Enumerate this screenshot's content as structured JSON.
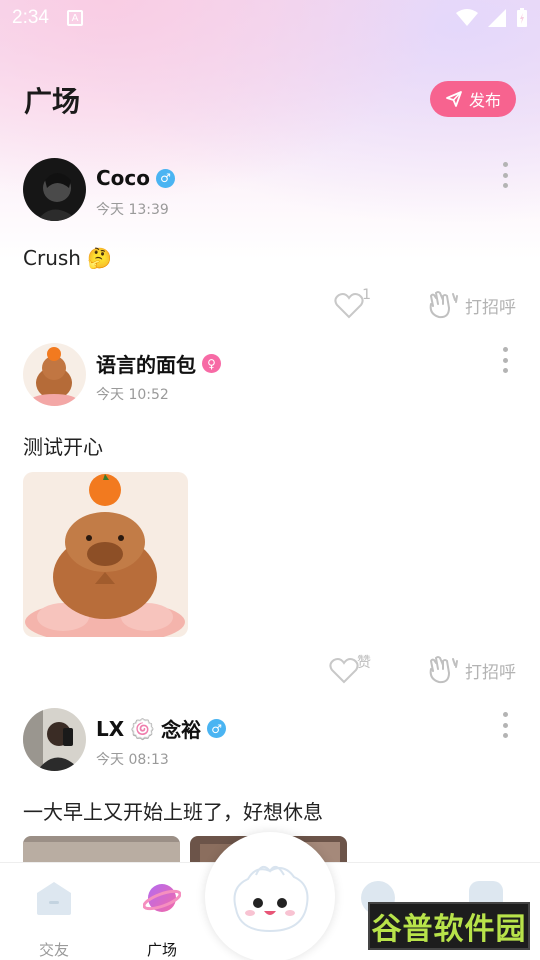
{
  "status_bar": {
    "time": "2:34",
    "a_badge": "A"
  },
  "header": {
    "title": "广场",
    "publish_label": "发布"
  },
  "posts": [
    {
      "username": "Coco",
      "gender": "male",
      "time": "今天 13:39",
      "text": "Crush",
      "emoji": "🤔",
      "like_count": "1",
      "greet_label": "打招呼"
    },
    {
      "username": "语言的面包",
      "gender": "female",
      "time": "今天 10:52",
      "text": "测试开心",
      "like_label": "赞",
      "greet_label": "打招呼"
    },
    {
      "username_prefix": "LX",
      "username_emoji": "🍥",
      "username_suffix": "念裕",
      "gender": "male",
      "time": "今天 08:13",
      "text": "一大早上又开始上班了，好想休息"
    }
  ],
  "tabbar": {
    "tabs": [
      {
        "label": "交友",
        "active": false
      },
      {
        "label": "广场",
        "active": true
      }
    ]
  },
  "watermark": {
    "text": "谷普软件园"
  },
  "colors": {
    "accent": "#f7638f",
    "male": "#4ab4f2",
    "female": "#f76aa5"
  }
}
